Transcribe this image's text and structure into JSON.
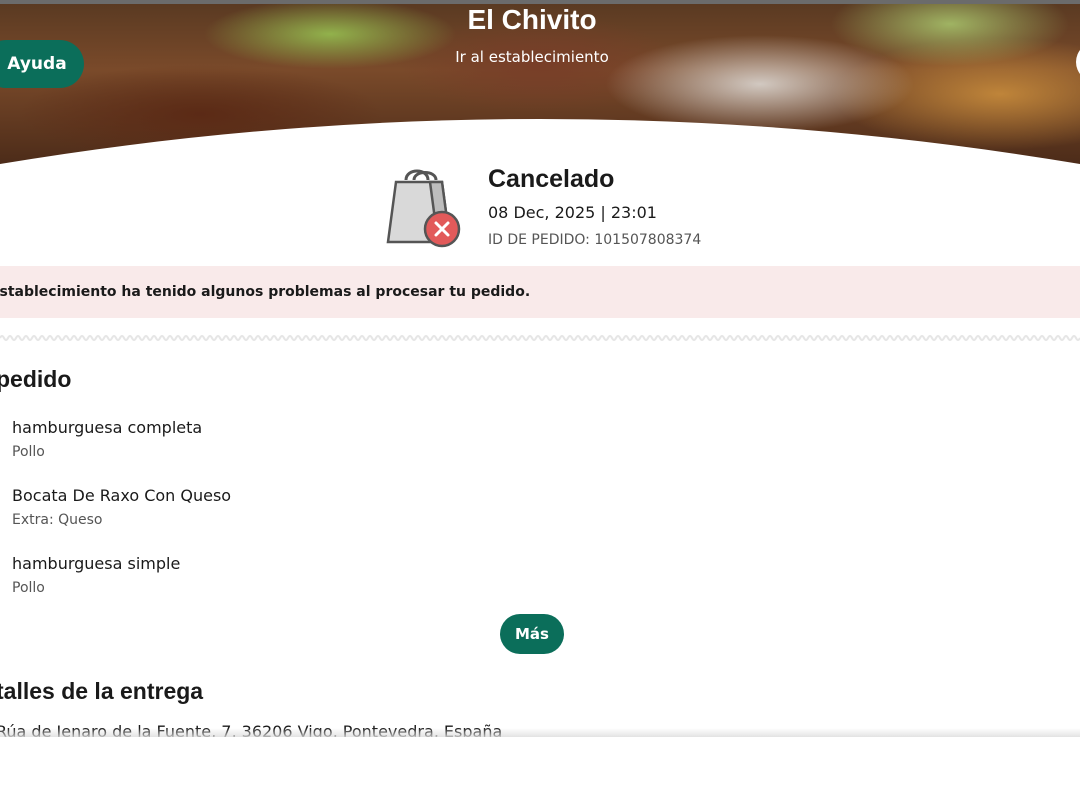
{
  "header": {
    "store_name": "El Chivito",
    "store_link": "Ir al establecimiento",
    "help_label": "Ayuda"
  },
  "order_status": {
    "title": "Cancelado",
    "datetime": "08 Dec, 2025 | 23:01",
    "order_id": "ID DE PEDIDO: 101507808374",
    "icon": "cancelled-bag-icon"
  },
  "alert": {
    "message": "establecimiento ha tenido algunos problemas al procesar tu pedido."
  },
  "order_section": {
    "title": "pedido",
    "items": [
      {
        "name": "hamburguesa completa",
        "detail": "Pollo"
      },
      {
        "name": "Bocata De Raxo Con Queso",
        "detail": "Extra: Queso"
      },
      {
        "name": "hamburguesa simple",
        "detail": "Pollo"
      }
    ],
    "more_label": "Más"
  },
  "delivery_section": {
    "title": "talles de la entrega",
    "address": "Rúa de Jenaro de la Fuente, 7, 36206 Vigo, Pontevedra, España"
  },
  "colors": {
    "accent": "#0b6e5a",
    "alert_bg": "#f9eaea",
    "cancel_red": "#e25a5a"
  }
}
